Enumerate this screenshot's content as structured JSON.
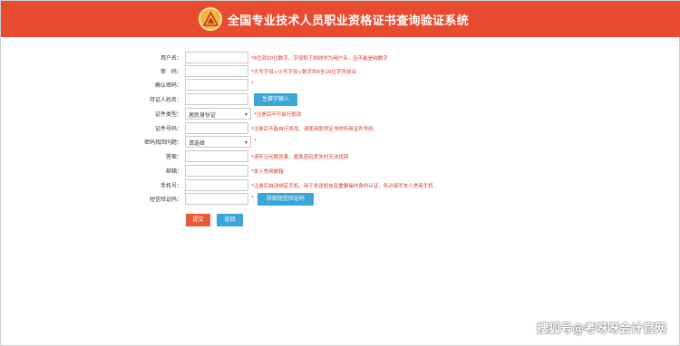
{
  "header": {
    "title": "全国专业技术人员职业资格证书查询验证系统"
  },
  "form": {
    "username": {
      "label": "用户名：",
      "hint": "*6位到20位数字、字母和下划线作为用户名，且不能是纯数字"
    },
    "password": {
      "label": "密　码：",
      "hint": "*大写字母+小写字母+数字的8至16位字符组合"
    },
    "confirm_password": {
      "label": "确认密码：",
      "hint": "*"
    },
    "holder_name": {
      "label": "持证人姓名：",
      "button": "生僻字输入"
    },
    "id_type": {
      "label": "证件类型：",
      "value": "居民身份证",
      "hint": "*注册后不可自行修改"
    },
    "id_number": {
      "label": "证件号码：",
      "hint": "*注册后不能自行修改，请使用取得证书时所用证件号码"
    },
    "security_question": {
      "label": "密码找回问题：",
      "value": "请选择",
      "hint": "*"
    },
    "answer": {
      "label": "答案：",
      "hint": "*请牢记问题答案，避免密码丢失时无法找回"
    },
    "email": {
      "label": "邮箱：",
      "hint": "*本人常用邮箱"
    },
    "phone": {
      "label": "手机号：",
      "hint": "*注册后自动绑定手机，用于发送短信及重要操作身份认证，务必填写本人常用手机"
    },
    "sms_code": {
      "label": "短信验证码：",
      "hint": "*",
      "button": "获取短信验证码"
    }
  },
  "actions": {
    "submit": "提交",
    "back": "返回"
  },
  "watermark": "搜狐号@考呀呀会计官网",
  "colors": {
    "header": "#e84b2f",
    "hint": "#d23a2a",
    "button_blue": "#3aa6d9",
    "button_red": "#ea5a34"
  }
}
